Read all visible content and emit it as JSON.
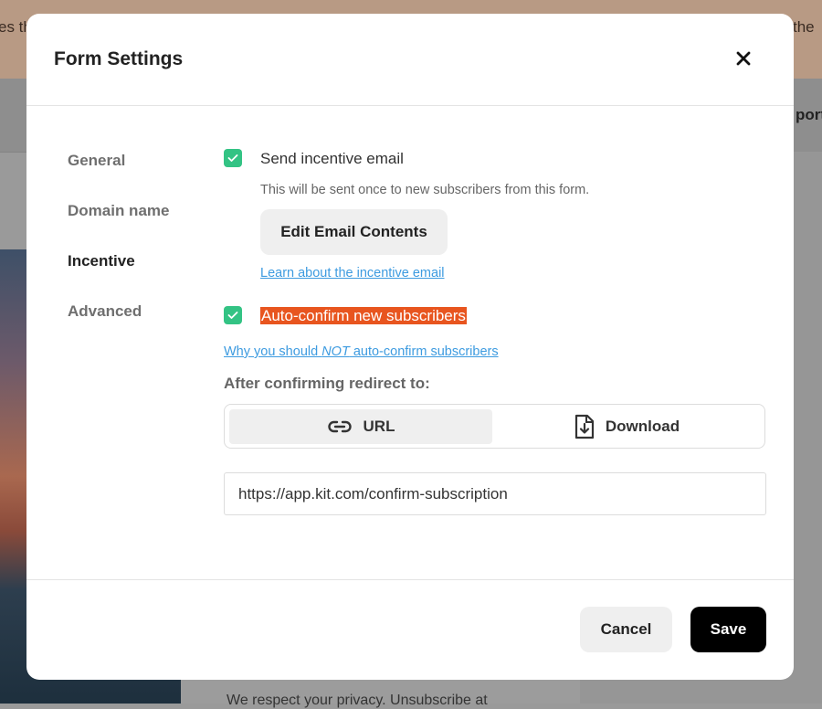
{
  "background": {
    "banner_text_left": "es th",
    "banner_text_right": "the",
    "nav_text": "port",
    "card_text": "We respect your privacy. Unsubscribe at"
  },
  "modal": {
    "title": "Form Settings",
    "close_icon": "close-icon",
    "nav": [
      "General",
      "Domain name",
      "Incentive",
      "Advanced"
    ],
    "active_nav": "Incentive",
    "incentive": {
      "send_email_checked": true,
      "send_email_label": "Send incentive email",
      "send_email_hint": "This will be sent once to new subscribers from this form.",
      "edit_button": "Edit Email Contents",
      "learn_link": "Learn about the incentive email",
      "auto_confirm_checked": true,
      "auto_confirm_label": "Auto-confirm new subscribers",
      "why_link_prefix": "Why you should ",
      "why_link_emphasis": "NOT",
      "why_link_suffix": " auto-confirm subscribers",
      "redirect_label": "After confirming redirect to:",
      "options": [
        {
          "label": "URL",
          "icon": "link-icon",
          "selected": true
        },
        {
          "label": "Download",
          "icon": "file-download-icon",
          "selected": false
        }
      ],
      "url_value": "https://app.kit.com/confirm-subscription"
    },
    "footer": {
      "cancel": "Cancel",
      "save": "Save"
    }
  },
  "colors": {
    "checkbox": "#33c384",
    "highlight": "#e8551f",
    "link": "#3d9be0",
    "primary_button": "#000000"
  }
}
